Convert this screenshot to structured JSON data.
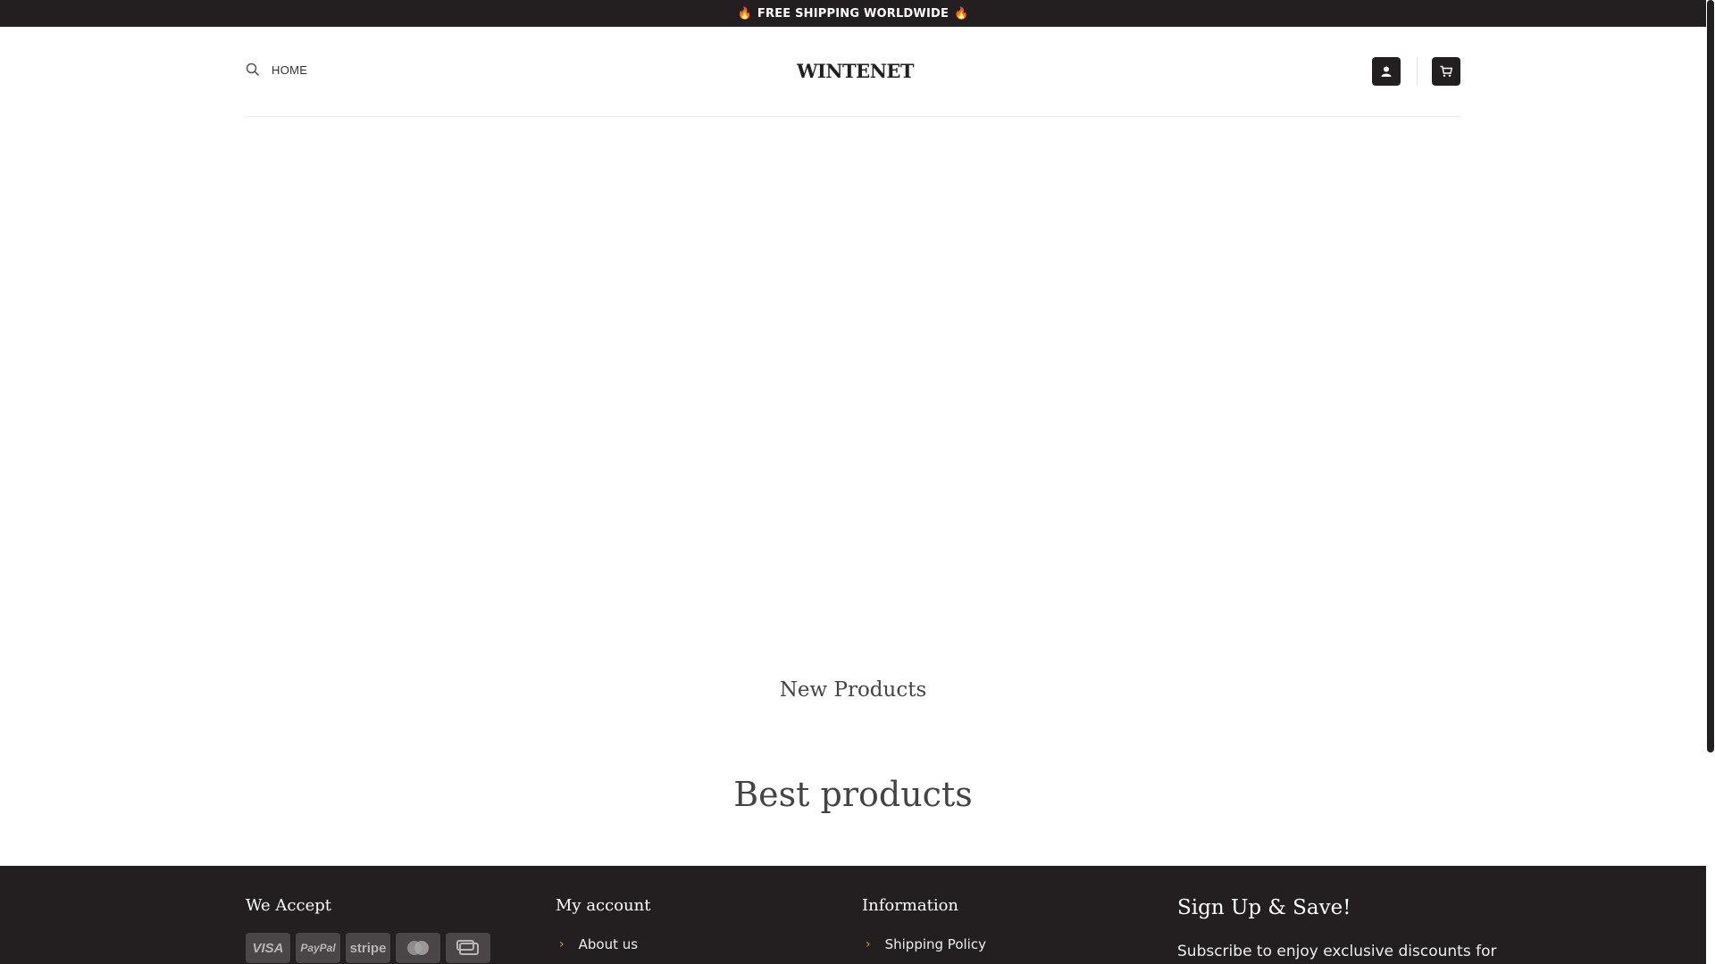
{
  "topbar": {
    "text": "FREE SHIPPING WORLDWIDE",
    "icon": "fire-icon"
  },
  "header": {
    "nav_home": "HOME",
    "logo": "WINTENET",
    "icons": {
      "search": "search-icon",
      "account": "user-icon",
      "cart": "cart-icon"
    }
  },
  "sections": {
    "new_products": "New Products",
    "best_products": "Best products"
  },
  "footer": {
    "we_accept": {
      "title": "We Accept",
      "cards": [
        "VISA",
        "PayPal",
        "stripe",
        "mastercard",
        "cash"
      ]
    },
    "my_account": {
      "title": "My account",
      "links": [
        "About us"
      ]
    },
    "information": {
      "title": "Information",
      "links": [
        "Shipping Policy"
      ]
    },
    "signup": {
      "title": "Sign Up & Save!",
      "text": "Subscribe to enjoy exclusive discounts for"
    }
  },
  "colors": {
    "dark": "#231f20",
    "accent": "#c9a04c",
    "flame": "#f47c20"
  }
}
